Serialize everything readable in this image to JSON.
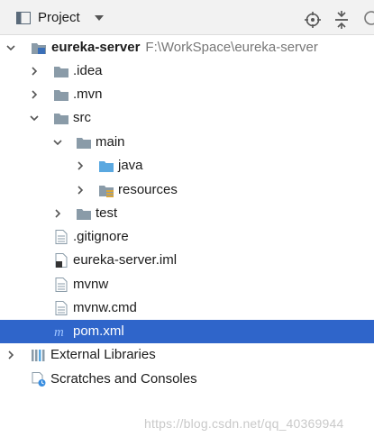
{
  "toolbar": {
    "title": "Project",
    "icons": [
      "project-view-icon",
      "dropdown-caret-icon",
      "locate-target-icon",
      "collapse-all-icon"
    ]
  },
  "tree": {
    "root": {
      "name": "eureka-server",
      "path": "F:\\WorkSpace\\eureka-server"
    },
    "idea": ".idea",
    "mvn": ".mvn",
    "src": "src",
    "main": "main",
    "java": "java",
    "resources": "resources",
    "test": "test",
    "gitignore": ".gitignore",
    "iml": "eureka-server.iml",
    "mvnw": "mvnw",
    "mvnw_cmd": "mvnw.cmd",
    "pom": "pom.xml",
    "external_libraries": "External Libraries",
    "scratches": "Scratches and Consoles"
  },
  "colors": {
    "selection": "#2f65ca",
    "folder": "#8a9ba8",
    "source_folder": "#5aa8e0",
    "maven": "#3a7bd5"
  },
  "watermark": "https://blog.csdn.net/qq_40369944"
}
